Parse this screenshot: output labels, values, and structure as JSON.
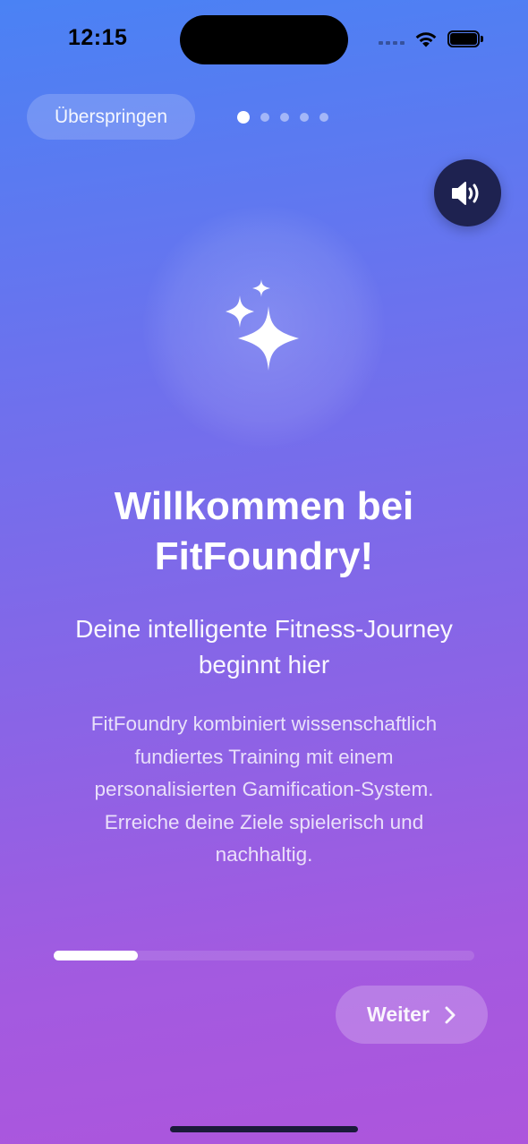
{
  "status_bar": {
    "time": "12:15",
    "icons": [
      "cellular-signal-icon",
      "wifi-icon",
      "battery-icon"
    ]
  },
  "header": {
    "skip_label": "Überspringen",
    "page_indicator": {
      "total": 5,
      "current": 1
    },
    "sound_icon": "speaker-wave-icon"
  },
  "hero": {
    "icon": "sparkles-icon",
    "title": "Willkommen bei FitFoundry!",
    "subtitle": "Deine intelligente Fitness-Journey beginnt hier",
    "description": "FitFoundry kombiniert wissenschaftlich fundiertes Training mit einem personalisierten Gamification-System. Erreiche deine Ziele spielerisch und nachhaltig."
  },
  "progress": {
    "value": 0.2
  },
  "footer": {
    "next_label": "Weiter",
    "next_icon": "chevron-right-icon"
  },
  "colors": {
    "gradient_top": "#4a82f4",
    "gradient_bottom": "#ad55dc",
    "sound_button_bg": "#1e2250",
    "text": "#ffffff"
  }
}
